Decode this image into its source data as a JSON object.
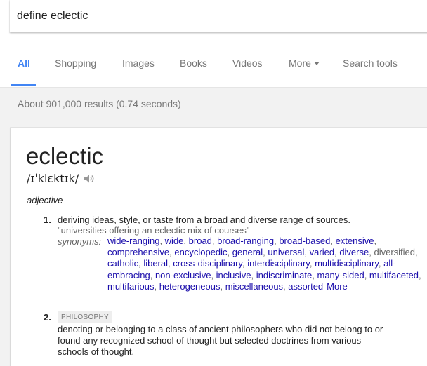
{
  "search": {
    "query": "define eclectic"
  },
  "tabs": [
    {
      "label": "All",
      "active": true
    },
    {
      "label": "Shopping"
    },
    {
      "label": "Images"
    },
    {
      "label": "Books"
    },
    {
      "label": "Videos"
    },
    {
      "label": "More"
    },
    {
      "label": "Search tools"
    }
  ],
  "result_stats": "About 901,000 results (0.74 seconds)",
  "definition": {
    "word": "eclectic",
    "pronunciation": "/ɪˈklɛktɪk/",
    "part_of_speech": "adjective",
    "senses": [
      {
        "number": "1.",
        "text": "deriving ideas, style, or taste from a broad and diverse range of sources.",
        "example": "\"universities offering an eclectic mix of courses\"",
        "synonyms_label": "synonyms:",
        "synonyms": [
          "wide-ranging",
          "wide",
          "broad",
          "broad-ranging",
          "broad-based",
          "extensive",
          "comprehensive",
          "encyclopedic",
          "general",
          "universal",
          "varied",
          "diverse",
          "diversified",
          "catholic",
          "liberal",
          "cross-disciplinary",
          "interdisciplinary",
          "multidisciplinary",
          "all-embracing",
          "non-exclusive",
          "inclusive",
          "indiscriminate",
          "many-sided",
          "multifaceted",
          "multifarious",
          "heterogeneous",
          "miscellaneous",
          "assorted"
        ],
        "more_label": "More"
      },
      {
        "number": "2.",
        "label": "PHILOSOPHY",
        "text_line1": "denoting or belonging to a class of ancient philosophers who did not belong to or",
        "text_line2": "found any recognized school of thought but selected doctrines from various",
        "text_line3": "schools of thought."
      }
    ]
  },
  "colors": {
    "accent": "#4285f4",
    "link": "#1a0dab",
    "muted": "#777777",
    "page_bg": "#f2f2f2"
  }
}
